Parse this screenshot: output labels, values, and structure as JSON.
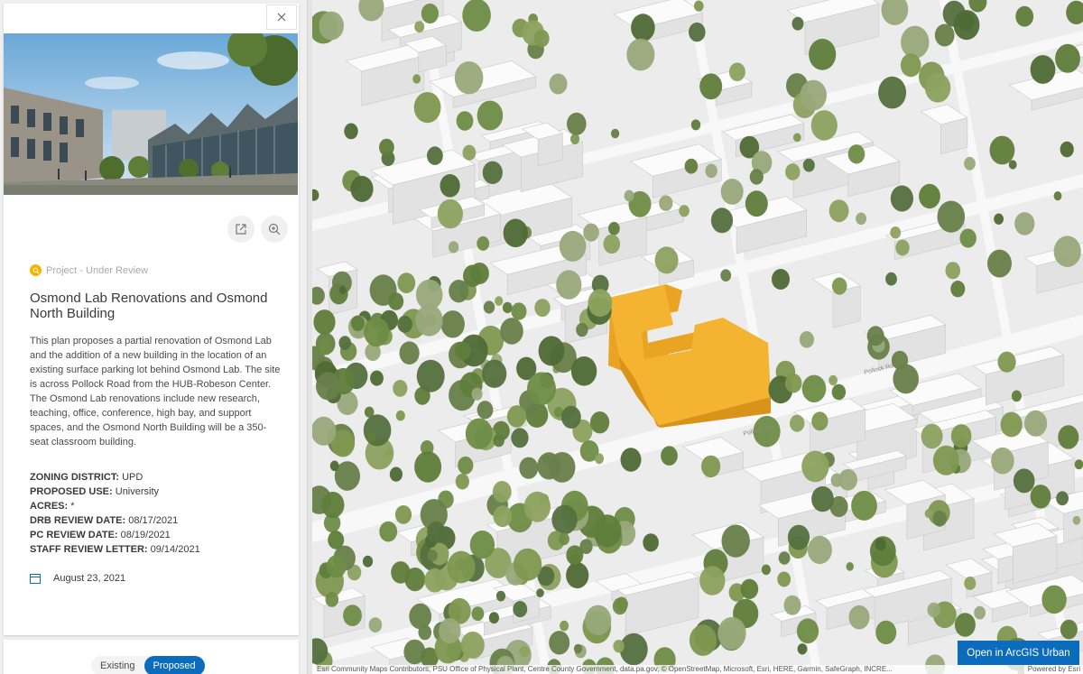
{
  "panel": {
    "close_icon": "close-icon",
    "image_alt": "Osmond building rendering",
    "actions": {
      "open_icon": "external-link-icon",
      "zoom_icon": "zoom-in-icon"
    },
    "status": "Project - Under Review",
    "title": "Osmond Lab Renovations and Osmond North Building",
    "description": "This plan proposes a partial renovation of Osmond Lab and the addition of a new building in the location of an existing surface parking lot behind Osmond Lab. The site is across Pollock Road from the HUB-Robeson Center. The Osmond Lab renovations include new research, teaching, office, conference, high bay, and support spaces, and the Osmond North Building will be a 350-seat classroom building.",
    "fields": [
      {
        "label": "ZONING DISTRICT:",
        "value": "UPD"
      },
      {
        "label": "PROPOSED USE:",
        "value": "University"
      },
      {
        "label": "ACRES:",
        "value": "*"
      },
      {
        "label": "DRB REVIEW DATE:",
        "value": "08/17/2021"
      },
      {
        "label": "PC REVIEW DATE:",
        "value": "08/19/2021"
      },
      {
        "label": "STAFF REVIEW LETTER:",
        "value": "09/14/2021"
      }
    ],
    "date": "August 23, 2021",
    "toggle": {
      "existing": "Existing",
      "proposed": "Proposed",
      "selected": "Proposed"
    }
  },
  "map": {
    "open_button": "Open in ArcGIS Urban",
    "street_labels": [
      "Pollock Rd",
      "Pollock Rd"
    ],
    "attribution": "Esri Community Maps Contributors, PSU Office of Physical Plant, Centre County Government, data.pa.gov, © OpenStreetMap, Microsoft, Esri, HERE, Garmin, SafeGraph, INCRE...",
    "powered_by": "Powered by Esri"
  },
  "colors": {
    "accent": "#0b6bbd",
    "status": "#f4b400",
    "proposed_building": "#f5b332"
  }
}
